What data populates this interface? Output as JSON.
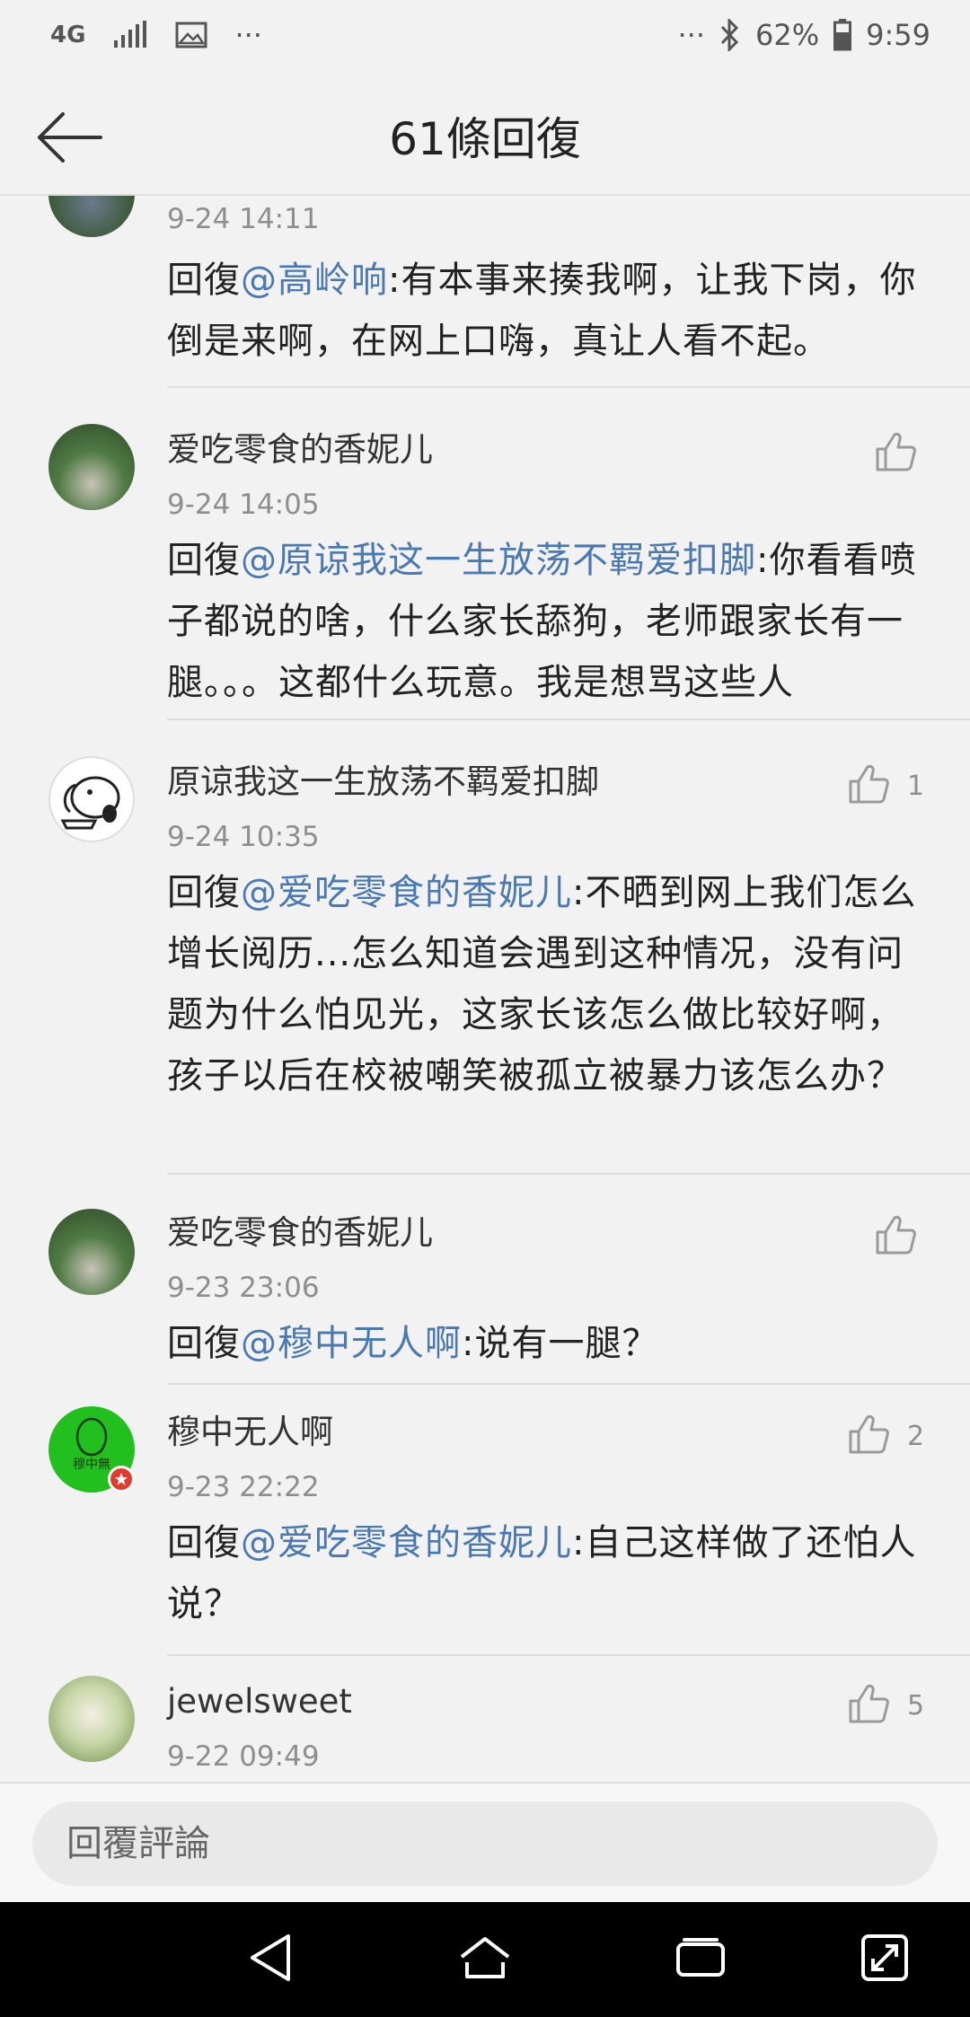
{
  "status_bar": {
    "network": "4G",
    "dots": "···",
    "dots_right": "···",
    "battery": "62%",
    "time": "9:59"
  },
  "header": {
    "title": "61條回復"
  },
  "comments": [
    {
      "name": "",
      "time": "9-24 14:11",
      "prefix": "回復",
      "mention": "@高岭响",
      "text": ":有本事来揍我啊，让我下岗，你倒是来啊，在网上口嗨，真让人看不起。",
      "likes": ""
    },
    {
      "name": "爱吃零食的香妮儿",
      "time": "9-24 14:05",
      "prefix": "回復",
      "mention": "@原谅我这一生放荡不羁爱扣脚",
      "text": ":你看看喷子都说的啥，什么家长舔狗，老师跟家长有一腿。。。这都什么玩意。我是想骂这些人",
      "likes": ""
    },
    {
      "name": "原谅我这一生放荡不羁爱扣脚",
      "time": "9-24 10:35",
      "prefix": "回復",
      "mention": "@爱吃零食的香妮儿",
      "text": ":不晒到网上我们怎么增长阅历...怎么知道会遇到这种情况，没有问题为什么怕见光，这家长该怎么做比较好啊，孩子以后在校被嘲笑被孤立被暴力该怎么办？",
      "likes": "1"
    },
    {
      "name": "爱吃零食的香妮儿",
      "time": "9-23 23:06",
      "prefix": "回復",
      "mention": "@穆中无人啊",
      "text": ":说有一腿？",
      "likes": ""
    },
    {
      "name": "穆中无人啊",
      "time": "9-23 22:22",
      "prefix": "回復",
      "mention": "@爱吃零食的香妮儿",
      "text": ":自己这样做了还怕人说？",
      "likes": "2"
    },
    {
      "name": "jewelsweet",
      "time": "9-22 09:49",
      "prefix": "",
      "mention": "",
      "text": "",
      "likes": "5"
    }
  ],
  "avatar_logo_text": "穆中無",
  "reply": {
    "placeholder": "回覆評論"
  },
  "colors": {
    "mention": "#4a78b2",
    "background": "#f2f2f2"
  },
  "icons": [
    "arrow-left-icon",
    "like-icon",
    "back-triangle-icon",
    "home-icon",
    "recents-icon",
    "expand-icon"
  ]
}
